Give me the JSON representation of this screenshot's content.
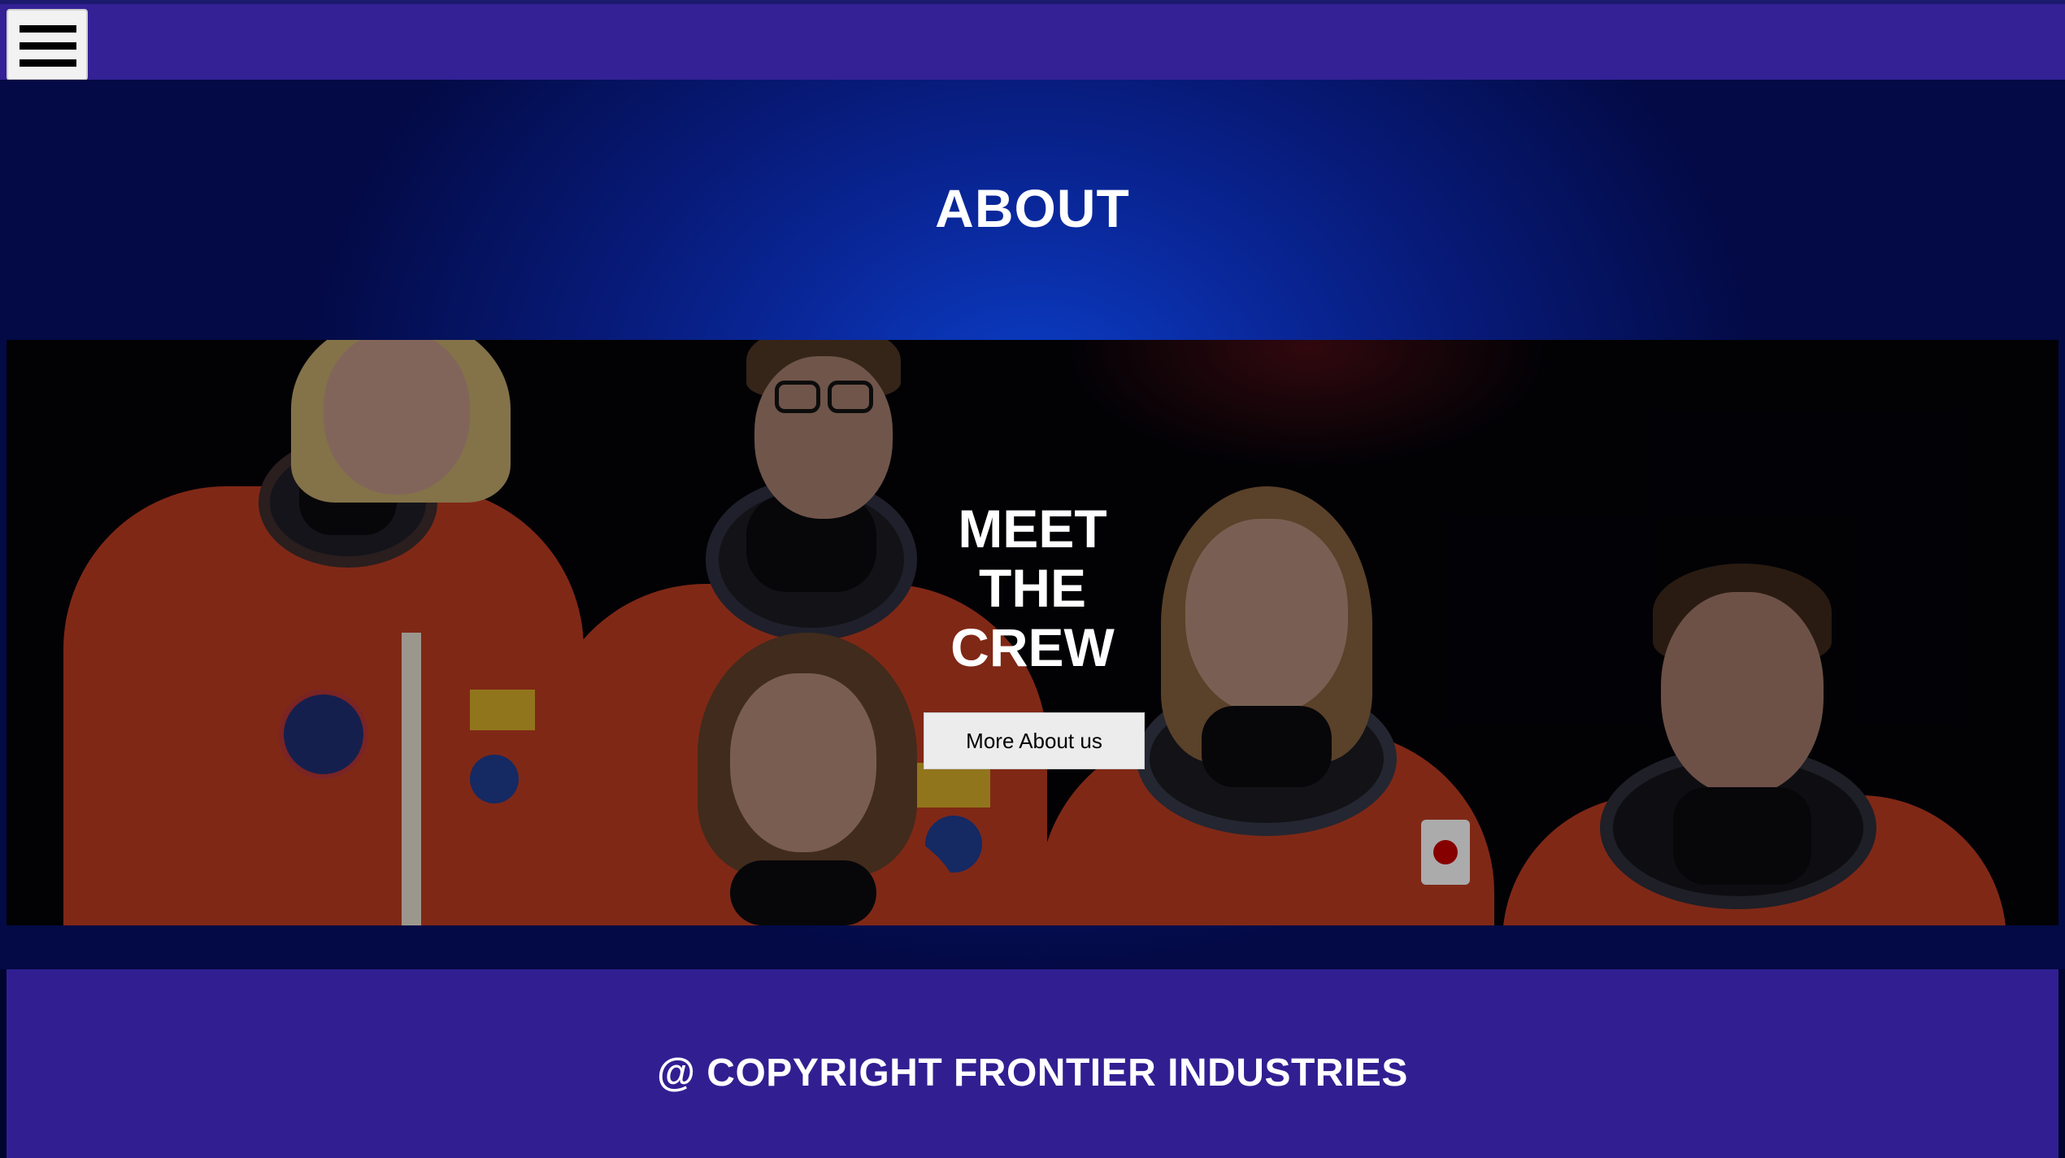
{
  "header": {
    "menu_icon": "hamburger-menu-icon"
  },
  "about": {
    "title": "ABOUT"
  },
  "crew_hero": {
    "title_lines": [
      "MEET",
      "THE",
      "CREW"
    ],
    "button_label": "More About us"
  },
  "footer": {
    "text": "@ COPYRIGHT FRONTIER INDUSTRIES"
  },
  "colors": {
    "header_bg": "#332195",
    "footer_bg": "#311f92",
    "main_gradient_center": "#0a3fc8",
    "suit_orange": "#b2381f",
    "button_bg": "#ececec"
  }
}
